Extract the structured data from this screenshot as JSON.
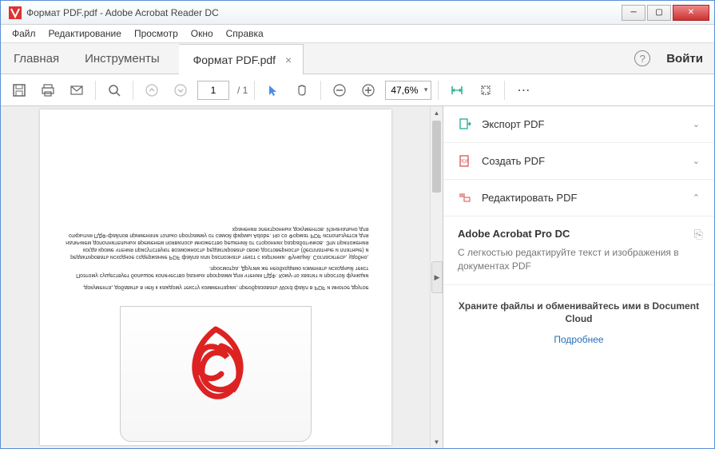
{
  "window": {
    "title": "Формат PDF.pdf - Adobe Acrobat Reader DC"
  },
  "menu": {
    "file": "Файл",
    "edit": "Редактирование",
    "view": "Просмотр",
    "window": "Окно",
    "help": "Справка"
  },
  "tabs": {
    "home": "Главная",
    "tools": "Инструменты",
    "file": "Формат PDF.pdf",
    "login": "Войти"
  },
  "toolbar": {
    "page_current": "1",
    "page_total": "/ 1",
    "zoom": "47,6%"
  },
  "document": {
    "p1": "документа, добавить в ней к каждому тексту комментарии, преобразовать Word файл в PDF и многое другое.",
    "p2": "Поэтому существует большое количество разных программ для чтения ПДФ. Кому-то хватит и простой функции просмотра. Другим же необходимо изменять исходный текст.",
    "p3": "редактировать исходное содержание PDF файла или распознать текст с картинки. Функций. Согласитесь, удобно, когда кроме чтения присутствуют возможность редактировать свою достоверность (бесплатные и платные) и наличием дополнительных временем появилось множество решений от сторонних разработчиков. Эти приложения открытия ПДФ-файлов применяли только программу от самой фирмы Adobe. Но со Формат PDF используется для хранения электронных документов. Изначально для"
  },
  "sidepanel": {
    "export": "Экспорт PDF",
    "create": "Создать PDF",
    "edit": "Редактировать PDF",
    "detail_title": "Adobe Acrobat Pro DC",
    "detail_text": "С легкостью редактируйте текст и изображения в документах PDF",
    "footer_text": "Храните файлы и обменивайтесь ими в Document Cloud",
    "footer_link": "Подробнее"
  }
}
